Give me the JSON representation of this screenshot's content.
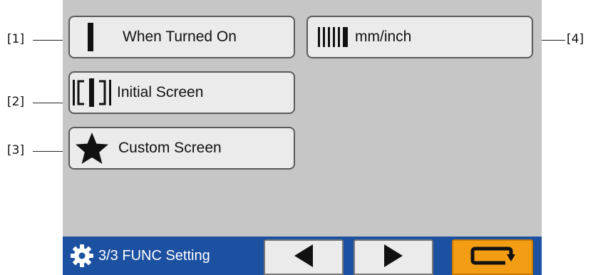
{
  "callouts": {
    "c1": "[1]",
    "c2": "[2]",
    "c3": "[3]",
    "c4": "[4]"
  },
  "buttons": {
    "when_turned_on": "When Turned On",
    "initial_screen": "Initial Screen",
    "custom_screen": "Custom Screen",
    "mm_inch": "mm/inch"
  },
  "status_bar": {
    "title": "3/3 FUNC Setting",
    "background": "#1c50a0",
    "return_color": "#f29d14"
  },
  "icons": {
    "when_turned_on": "single-bar-icon",
    "initial_screen": "bracket-bar-icon",
    "custom_screen": "star-icon",
    "mm_inch": "ruler-lines-icon",
    "bar_title": "gear-icon",
    "prev": "triangle-left-icon",
    "next": "triangle-right-icon",
    "return": "return-arrow-icon"
  }
}
